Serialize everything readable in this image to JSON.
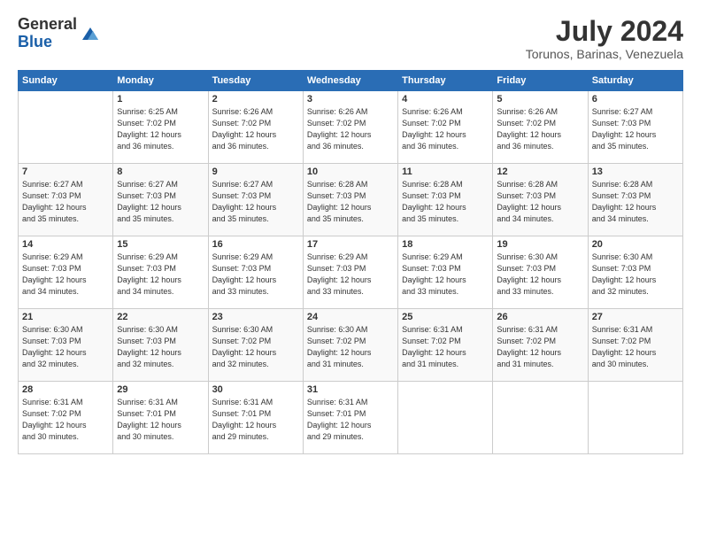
{
  "header": {
    "logo_general": "General",
    "logo_blue": "Blue",
    "month_year": "July 2024",
    "location": "Torunos, Barinas, Venezuela"
  },
  "days_of_week": [
    "Sunday",
    "Monday",
    "Tuesday",
    "Wednesday",
    "Thursday",
    "Friday",
    "Saturday"
  ],
  "weeks": [
    [
      {
        "num": "",
        "info": ""
      },
      {
        "num": "1",
        "info": "Sunrise: 6:25 AM\nSunset: 7:02 PM\nDaylight: 12 hours\nand 36 minutes."
      },
      {
        "num": "2",
        "info": "Sunrise: 6:26 AM\nSunset: 7:02 PM\nDaylight: 12 hours\nand 36 minutes."
      },
      {
        "num": "3",
        "info": "Sunrise: 6:26 AM\nSunset: 7:02 PM\nDaylight: 12 hours\nand 36 minutes."
      },
      {
        "num": "4",
        "info": "Sunrise: 6:26 AM\nSunset: 7:02 PM\nDaylight: 12 hours\nand 36 minutes."
      },
      {
        "num": "5",
        "info": "Sunrise: 6:26 AM\nSunset: 7:02 PM\nDaylight: 12 hours\nand 36 minutes."
      },
      {
        "num": "6",
        "info": "Sunrise: 6:27 AM\nSunset: 7:03 PM\nDaylight: 12 hours\nand 35 minutes."
      }
    ],
    [
      {
        "num": "7",
        "info": "Sunrise: 6:27 AM\nSunset: 7:03 PM\nDaylight: 12 hours\nand 35 minutes."
      },
      {
        "num": "8",
        "info": "Sunrise: 6:27 AM\nSunset: 7:03 PM\nDaylight: 12 hours\nand 35 minutes."
      },
      {
        "num": "9",
        "info": "Sunrise: 6:27 AM\nSunset: 7:03 PM\nDaylight: 12 hours\nand 35 minutes."
      },
      {
        "num": "10",
        "info": "Sunrise: 6:28 AM\nSunset: 7:03 PM\nDaylight: 12 hours\nand 35 minutes."
      },
      {
        "num": "11",
        "info": "Sunrise: 6:28 AM\nSunset: 7:03 PM\nDaylight: 12 hours\nand 35 minutes."
      },
      {
        "num": "12",
        "info": "Sunrise: 6:28 AM\nSunset: 7:03 PM\nDaylight: 12 hours\nand 34 minutes."
      },
      {
        "num": "13",
        "info": "Sunrise: 6:28 AM\nSunset: 7:03 PM\nDaylight: 12 hours\nand 34 minutes."
      }
    ],
    [
      {
        "num": "14",
        "info": "Sunrise: 6:29 AM\nSunset: 7:03 PM\nDaylight: 12 hours\nand 34 minutes."
      },
      {
        "num": "15",
        "info": "Sunrise: 6:29 AM\nSunset: 7:03 PM\nDaylight: 12 hours\nand 34 minutes."
      },
      {
        "num": "16",
        "info": "Sunrise: 6:29 AM\nSunset: 7:03 PM\nDaylight: 12 hours\nand 33 minutes."
      },
      {
        "num": "17",
        "info": "Sunrise: 6:29 AM\nSunset: 7:03 PM\nDaylight: 12 hours\nand 33 minutes."
      },
      {
        "num": "18",
        "info": "Sunrise: 6:29 AM\nSunset: 7:03 PM\nDaylight: 12 hours\nand 33 minutes."
      },
      {
        "num": "19",
        "info": "Sunrise: 6:30 AM\nSunset: 7:03 PM\nDaylight: 12 hours\nand 33 minutes."
      },
      {
        "num": "20",
        "info": "Sunrise: 6:30 AM\nSunset: 7:03 PM\nDaylight: 12 hours\nand 32 minutes."
      }
    ],
    [
      {
        "num": "21",
        "info": "Sunrise: 6:30 AM\nSunset: 7:03 PM\nDaylight: 12 hours\nand 32 minutes."
      },
      {
        "num": "22",
        "info": "Sunrise: 6:30 AM\nSunset: 7:03 PM\nDaylight: 12 hours\nand 32 minutes."
      },
      {
        "num": "23",
        "info": "Sunrise: 6:30 AM\nSunset: 7:02 PM\nDaylight: 12 hours\nand 32 minutes."
      },
      {
        "num": "24",
        "info": "Sunrise: 6:30 AM\nSunset: 7:02 PM\nDaylight: 12 hours\nand 31 minutes."
      },
      {
        "num": "25",
        "info": "Sunrise: 6:31 AM\nSunset: 7:02 PM\nDaylight: 12 hours\nand 31 minutes."
      },
      {
        "num": "26",
        "info": "Sunrise: 6:31 AM\nSunset: 7:02 PM\nDaylight: 12 hours\nand 31 minutes."
      },
      {
        "num": "27",
        "info": "Sunrise: 6:31 AM\nSunset: 7:02 PM\nDaylight: 12 hours\nand 30 minutes."
      }
    ],
    [
      {
        "num": "28",
        "info": "Sunrise: 6:31 AM\nSunset: 7:02 PM\nDaylight: 12 hours\nand 30 minutes."
      },
      {
        "num": "29",
        "info": "Sunrise: 6:31 AM\nSunset: 7:01 PM\nDaylight: 12 hours\nand 30 minutes."
      },
      {
        "num": "30",
        "info": "Sunrise: 6:31 AM\nSunset: 7:01 PM\nDaylight: 12 hours\nand 29 minutes."
      },
      {
        "num": "31",
        "info": "Sunrise: 6:31 AM\nSunset: 7:01 PM\nDaylight: 12 hours\nand 29 minutes."
      },
      {
        "num": "",
        "info": ""
      },
      {
        "num": "",
        "info": ""
      },
      {
        "num": "",
        "info": ""
      }
    ]
  ]
}
